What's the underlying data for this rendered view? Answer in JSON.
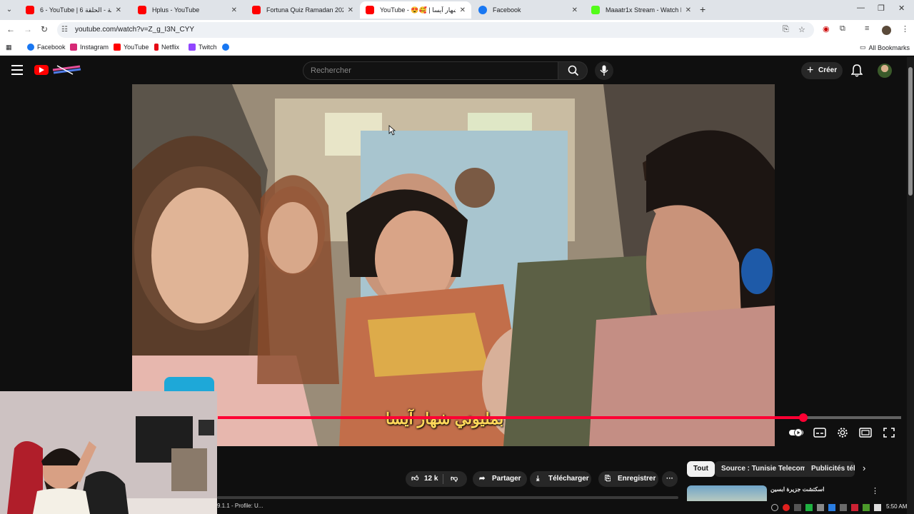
{
  "browser": {
    "tabs": [
      {
        "title": "6 - YouTube | طلوحة - الحلقة 6",
        "favicon": "youtube-icon",
        "color": "#ff0000",
        "active": false
      },
      {
        "title": "Hplus - YouTube",
        "favicon": "youtube-icon",
        "color": "#ff0000",
        "active": false
      },
      {
        "title": "Fortuna Quiz Ramadan 2023 - Y",
        "favicon": "youtube-icon",
        "color": "#ff0000",
        "active": false
      },
      {
        "title": "YouTube - 😍🥰 | بمليوني شهار آيسا",
        "favicon": "youtube-icon",
        "color": "#ff0000",
        "active": true
      },
      {
        "title": "Facebook",
        "favicon": "facebook-icon",
        "color": "#1877f2",
        "active": false
      },
      {
        "title": "Maaatr1x Stream - Watch Live o",
        "favicon": "kick-icon",
        "color": "#53fc18",
        "active": false
      }
    ],
    "url": "youtube.com/watch?v=Z_g_I3N_CYY",
    "bookmarks": [
      {
        "label": "Facebook",
        "icon": "facebook-icon",
        "color": "#1877f2"
      },
      {
        "label": "Instagram",
        "icon": "instagram-icon",
        "color": "#d62976"
      },
      {
        "label": "YouTube",
        "icon": "youtube-icon",
        "color": "#ff0000"
      },
      {
        "label": "Netflix",
        "icon": "netflix-icon",
        "color": "#e50914"
      },
      {
        "label": "Twitch",
        "icon": "twitch-icon",
        "color": "#9146ff"
      },
      {
        "label": "",
        "icon": "facebook-icon",
        "color": "#1877f2"
      }
    ],
    "all_bookmarks": "All Bookmarks"
  },
  "youtube": {
    "search_placeholder": "Rechercher",
    "create_label": "Créer",
    "subtitle": "بمليوني شهار آيسا",
    "progress": 0.857,
    "actions": {
      "likes": "12 k",
      "share": "Partager",
      "download": "Télécharger",
      "save": "Enregistrer"
    },
    "chips": [
      "Tout",
      "Source : Tunisie Telecom",
      "Publicités télé"
    ],
    "related_title": "اسكتشت جزيرة ابسين"
  },
  "taskbar": {
    "label": "9.1.1 - Profile: U...",
    "time": "5:50 AM"
  }
}
